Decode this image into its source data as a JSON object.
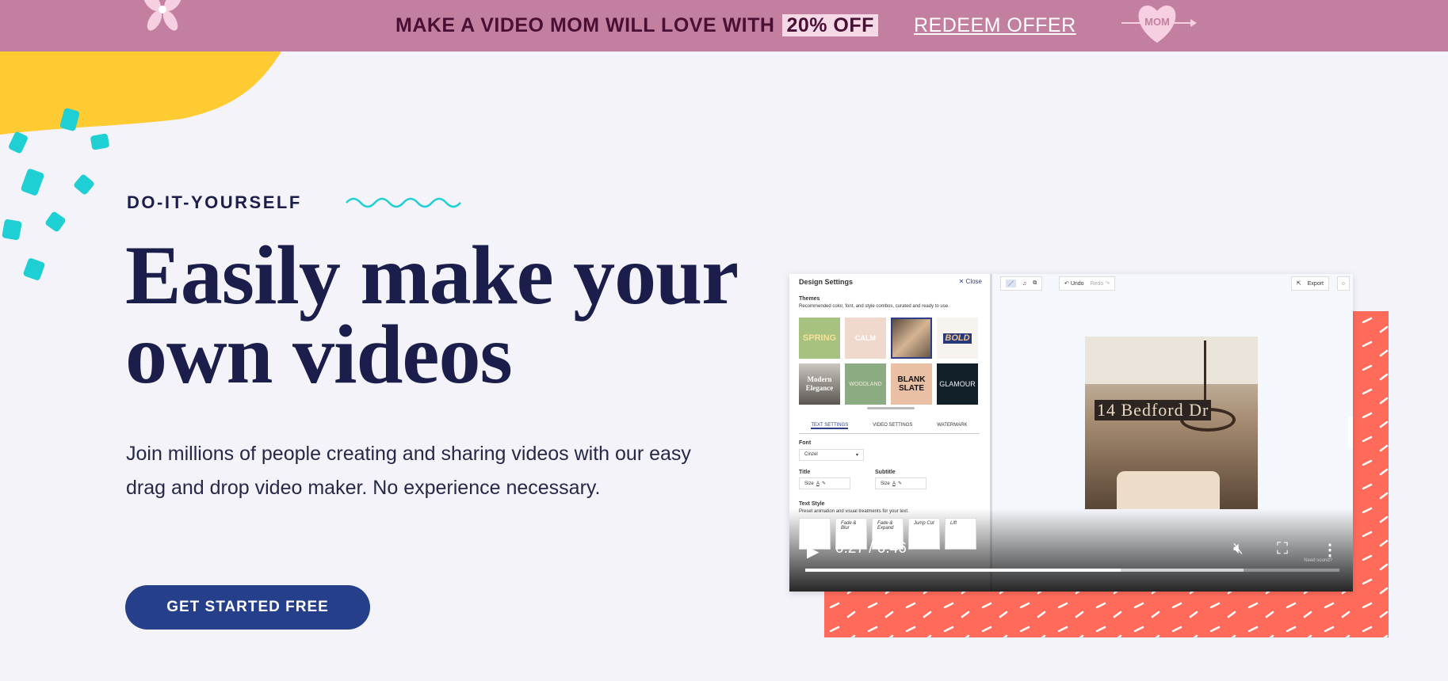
{
  "banner": {
    "promo_text": "MAKE A VIDEO MOM WILL LOVE WITH",
    "promo_highlight": "20% OFF",
    "redeem_label": "REDEEM OFFER",
    "heart_text": "MOM",
    "background": "#c27f9f"
  },
  "hero": {
    "eyebrow": "DO-IT-YOURSELF",
    "title_line1": "Easily make your",
    "title_line2": "own videos",
    "description": "Join millions of people creating and sharing videos with our easy drag and drop video maker. No experience necessary.",
    "cta_label": "GET STARTED FREE",
    "cta_color": "#253f8b"
  },
  "editor": {
    "panel_title": "Design Settings",
    "close_label": "Close",
    "themes_label": "Themes",
    "themes_desc": "Recommended color, font, and style combos, curated and ready to use.",
    "themes": [
      "SPRING",
      "CALM",
      "",
      "BOLD",
      "Modern Elegance",
      "WOODLAND",
      "BLANK SLATE",
      "GLAMOUR"
    ],
    "tabs": [
      "TEXT SETTINGS",
      "VIDEO SETTINGS",
      "WATERMARK"
    ],
    "font_label": "Font",
    "font_value": "Cinzel",
    "title_label": "Title",
    "subtitle_label": "Subtitle",
    "size_label": "Size",
    "text_style_label": "Text Style",
    "text_style_desc": "Preset animation and visual treatments for your text.",
    "text_styles": [
      "",
      "Fade & Blur",
      "Fade & Expand",
      "Jump Cut",
      "Lift"
    ],
    "undo_label": "Undo",
    "redo_label": "Redo",
    "export_label": "Export",
    "preview_caption": "14 Bedford Dr",
    "need_sound": "Need sound?"
  },
  "player": {
    "current_time": "0:27",
    "duration": "0:46",
    "time_display": "0:27 / 0:46",
    "progress_fraction": 0.59,
    "buffered_fraction": 0.82
  }
}
